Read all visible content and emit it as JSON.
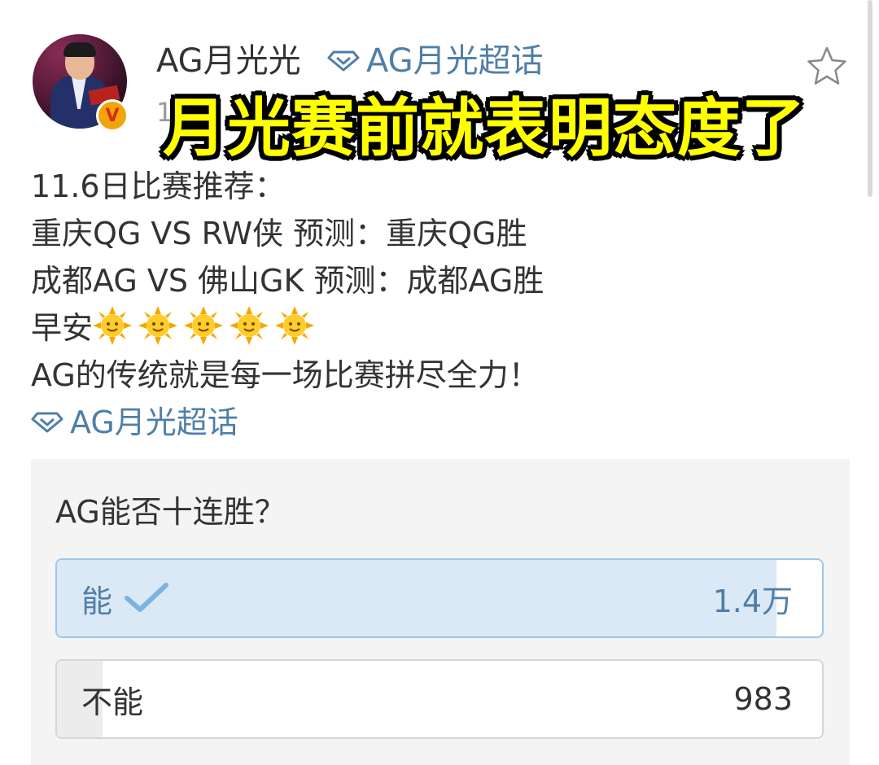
{
  "post": {
    "username": "AG月光光",
    "topic_tag": "AG月光超话",
    "time_fragment": "1",
    "verified_badge": "V",
    "icons": [
      "diamond-icon",
      "star-icon",
      "sun-emoji",
      "check-icon"
    ],
    "body_lines": [
      "11.6日比赛推荐：",
      "重庆QG VS RW侠 预测：重庆QG胜",
      "成都AG VS 佛山GK 预测：成都AG胜",
      "早安",
      "AG的传统就是每一场比赛拼尽全力！"
    ],
    "inline_topic": "AG月光超话"
  },
  "overlay": {
    "caption": "月光赛前就表明态度了"
  },
  "poll": {
    "question": "AG能否十连胜？",
    "options": [
      {
        "label": "能",
        "count": "1.4万",
        "selected": true,
        "fill_fraction": 0.94
      },
      {
        "label": "不能",
        "count": "983",
        "selected": false,
        "fill_fraction": 0.06
      }
    ]
  },
  "colors": {
    "link_blue": "#4f7fa8",
    "caption_yellow": "#ffff00",
    "poll_selected_fill": "#dbe9f6",
    "badge_orange": "#f2a50a"
  }
}
